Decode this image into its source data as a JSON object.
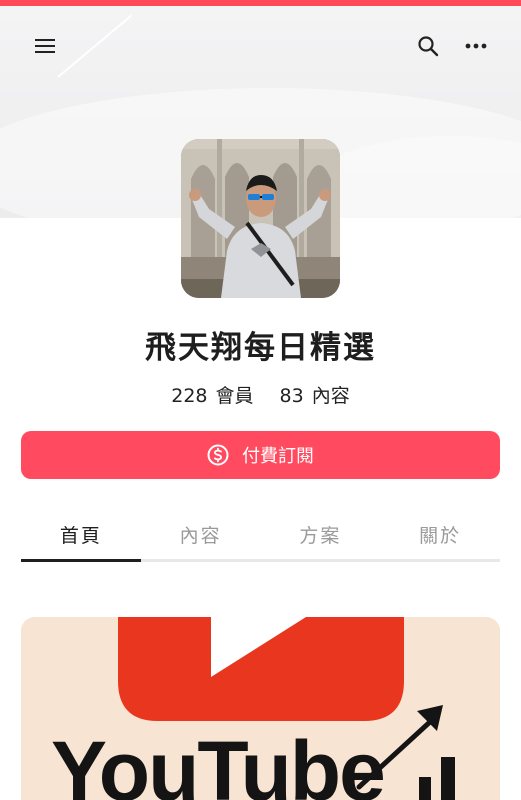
{
  "header": {
    "menu_icon": "hamburger-menu-icon",
    "search_icon": "search-icon",
    "more_icon": "more-horizontal-icon"
  },
  "profile": {
    "name": "飛天翔每日精選",
    "members_count": "228",
    "members_label": "會員",
    "content_count": "83",
    "content_label": "內容"
  },
  "subscribe": {
    "label": "付費訂閱",
    "icon": "dollar-coin-icon"
  },
  "tabs": [
    {
      "label": "首頁",
      "active": true
    },
    {
      "label": "內容",
      "active": false
    },
    {
      "label": "方案",
      "active": false
    },
    {
      "label": "關於",
      "active": false
    }
  ],
  "card": {
    "brand_text": "YouTube"
  },
  "colors": {
    "accent": "#ff4a5f",
    "youtube_red": "#e8361f",
    "card_bg": "#f7e4d2"
  }
}
